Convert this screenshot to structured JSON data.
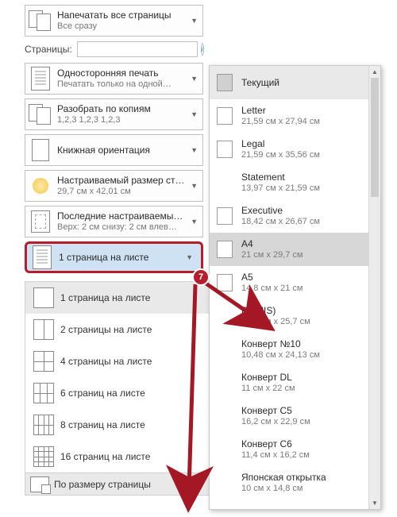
{
  "left": {
    "print_all": {
      "title": "Напечатать все страницы",
      "sub": "Все сразу"
    },
    "pages_label": "Страницы:",
    "pages_value": "",
    "one_side": {
      "title": "Односторонняя печать",
      "sub": "Печатать только на одной…"
    },
    "collate": {
      "title": "Разобрать по копиям",
      "sub": "1,2,3    1,2,3    1,2,3"
    },
    "orient": {
      "title": "Книжная ориентация",
      "sub": ""
    },
    "custom_size": {
      "title": "Настраиваемый размер ст…",
      "sub": "29,7 см x 42,01 см"
    },
    "margins": {
      "title": "Последние настраиваемы…",
      "sub": "Верх: 2 см снизу: 2 см влев…"
    },
    "pages_per_sheet": {
      "title": "1 страница на листе",
      "sub": ""
    }
  },
  "submenu": {
    "items": [
      {
        "label": "1 страница на листе",
        "cols": 1,
        "rows": 1,
        "selected": true
      },
      {
        "label": "2 страницы на листе",
        "cols": 2,
        "rows": 1
      },
      {
        "label": "4 страницы на листе",
        "cols": 2,
        "rows": 2
      },
      {
        "label": "6 страниц на листе",
        "cols": 3,
        "rows": 2
      },
      {
        "label": "8 страниц на листе",
        "cols": 4,
        "rows": 2
      },
      {
        "label": "16 страниц на листе",
        "cols": 4,
        "rows": 4
      }
    ],
    "footer": "По размеру страницы"
  },
  "popup": {
    "header": "Текущий",
    "items": [
      {
        "name": "Letter",
        "dim": "21,59 см x 27,94 см",
        "ico": true
      },
      {
        "name": "Legal",
        "dim": "21,59 см x 35,56 см",
        "ico": true
      },
      {
        "name": "Statement",
        "dim": "13,97 см x 21,59 см",
        "ico": false
      },
      {
        "name": "Executive",
        "dim": "18,42 см x 26,67 см",
        "ico": true
      },
      {
        "name": "A4",
        "dim": "21 см x 29,7 см",
        "ico": true,
        "selected": true
      },
      {
        "name": "А5",
        "dim": "14,8 см x 21 см",
        "ico": true
      },
      {
        "name": "B5 (JIS)",
        "dim": "18,2 см x 25,7 см",
        "ico": false
      },
      {
        "name": "Конверт №10",
        "dim": "10,48 см x 24,13 см",
        "ico": false
      },
      {
        "name": "Конверт DL",
        "dim": "11 см x 22 см",
        "ico": false
      },
      {
        "name": "Конверт C5",
        "dim": "16,2 см x 22,9 см",
        "ico": false
      },
      {
        "name": "Конверт C6",
        "dim": "11,4 см x 16,2 см",
        "ico": false
      },
      {
        "name": "Японская открытка",
        "dim": "10 см x 14,8 см",
        "ico": false
      }
    ]
  },
  "badge": "7"
}
